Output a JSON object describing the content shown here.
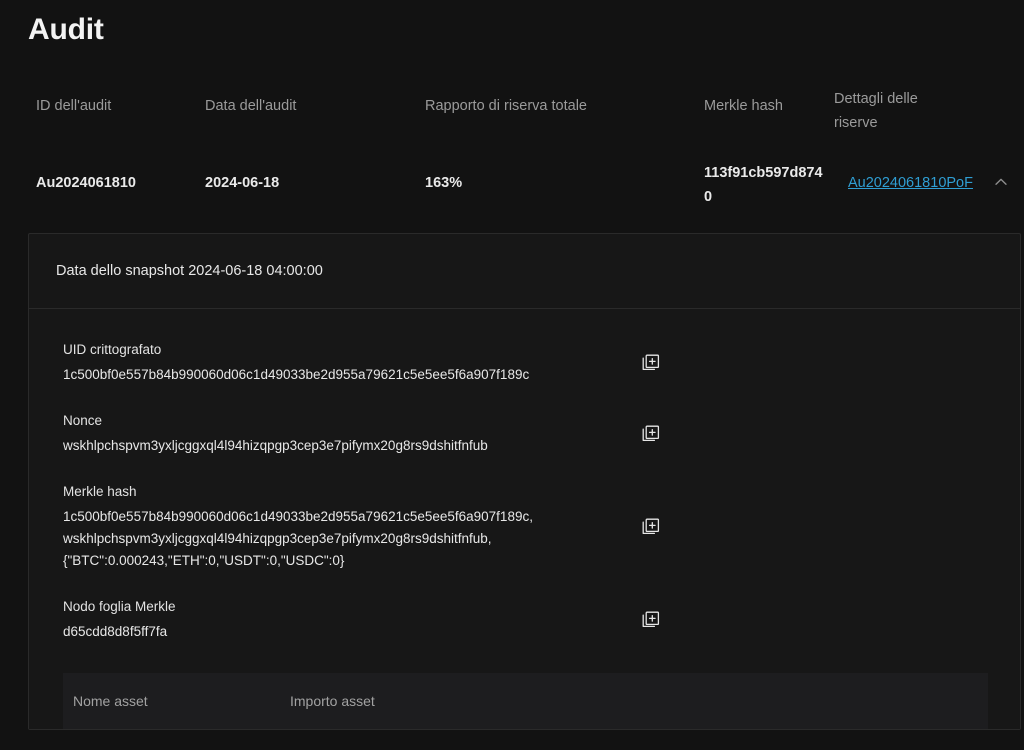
{
  "page": {
    "title": "Audit"
  },
  "audit_table": {
    "columns": [
      {
        "key": "audit_id",
        "label": "ID dell'audit"
      },
      {
        "key": "audit_date",
        "label": "Data dell'audit"
      },
      {
        "key": "reserve_ratio",
        "label": "Rapporto di riserva totale"
      },
      {
        "key": "merkle_hash",
        "label": "Merkle hash"
      },
      {
        "key": "reserve_details",
        "label": "Dettagli delle riserve"
      }
    ],
    "rows": [
      {
        "audit_id": "Au2024061810",
        "audit_date": "2024-06-18",
        "reserve_ratio": "163%",
        "merkle_hash": "113f91cb597d8740",
        "reserve_details_link": "Au2024061810PoF",
        "expand_icon": "chevron-up-icon",
        "expanded": true
      }
    ]
  },
  "expanded_panel": {
    "snapshot_label": "Data dello snapshot 2024-06-18 04:00:00",
    "fields": [
      {
        "label": "UID crittografato",
        "value_lines": [
          "1c500bf0e557b84b990060d06c1d49033be2d955a79621c5e5ee5f6a907f189c"
        ],
        "copy_icon": "copy-icon"
      },
      {
        "label": "Nonce",
        "value_lines": [
          "wskhlpchspvm3yxljcggxql4l94hizqpgp3cep3e7pifymx20g8rs9dshitfnfub"
        ],
        "copy_icon": "copy-icon"
      },
      {
        "label": "Merkle hash",
        "value_lines": [
          "1c500bf0e557b84b990060d06c1d49033be2d955a79621c5e5ee5f6a907f189c,",
          "wskhlpchspvm3yxljcggxql4l94hizqpgp3cep3e7pifymx20g8rs9dshitfnfub,",
          "{\"BTC\":0.000243,\"ETH\":0,\"USDT\":0,\"USDC\":0}"
        ],
        "copy_icon": "copy-icon"
      },
      {
        "label": "Nodo foglia Merkle",
        "value_lines": [
          "d65cdd8d8f5ff7fa"
        ],
        "copy_icon": "copy-icon"
      }
    ],
    "asset_table": {
      "columns": [
        {
          "key": "asset_name",
          "label": "Nome asset"
        },
        {
          "key": "asset_amount",
          "label": "Importo asset"
        }
      ],
      "rows": []
    }
  },
  "colors": {
    "background": "#121212",
    "panel": "#171717",
    "subtable": "#1d1d1f",
    "border": "#2a2a2a",
    "text_primary": "#eaeaea",
    "text_muted": "#9b9b9b",
    "link": "#2f9ed3"
  }
}
